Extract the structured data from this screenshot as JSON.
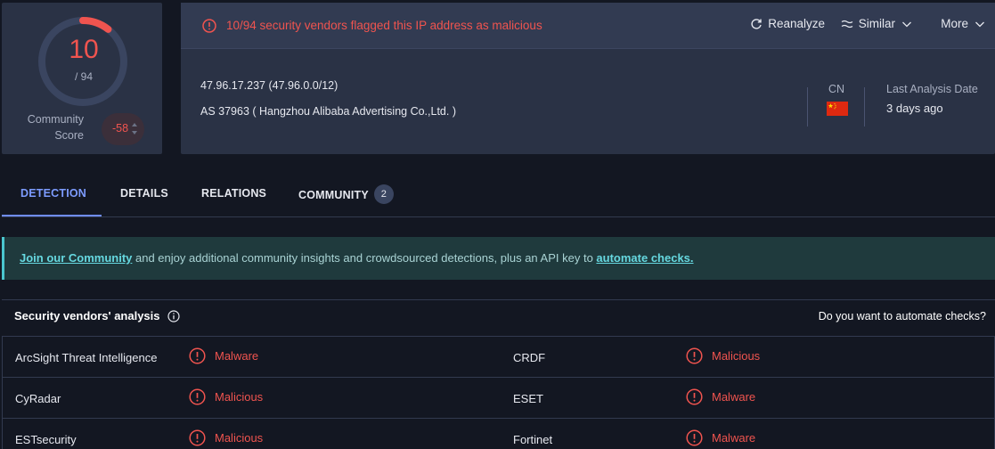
{
  "colors": {
    "accent": "#7d9cff",
    "danger": "#f0544f",
    "teal": "#66d8e0",
    "card": "#2a3245",
    "background": "#131722"
  },
  "score": {
    "detected": "10",
    "total": "/ 94",
    "community_label_1": "Community",
    "community_label_2": "Score",
    "community_value": "-58",
    "detection_ratio": 0.106
  },
  "header": {
    "alert_text": "10/94 security vendors flagged this IP address as malicious",
    "actions": {
      "reanalyze": "Reanalyze",
      "similar": "Similar",
      "more": "More"
    },
    "ip_line": "47.96.17.237  (47.96.0.0/12)",
    "as_line": "AS 37963  ( Hangzhou Alibaba Advertising Co.,Ltd. )",
    "country_code": "CN",
    "last_analysis_label": "Last Analysis Date",
    "last_analysis_value": "3 days ago"
  },
  "tabs": [
    {
      "label": "DETECTION"
    },
    {
      "label": "DETAILS"
    },
    {
      "label": "RELATIONS"
    },
    {
      "label": "COMMUNITY",
      "badge": "2"
    }
  ],
  "banner": {
    "link1": "Join our Community",
    "text": " and enjoy additional community insights and crowdsourced detections, plus an API key to ",
    "link2": "automate checks."
  },
  "vendors": {
    "title": "Security vendors' analysis",
    "automate_prompt": "Do you want to automate checks?",
    "rows": [
      {
        "left_name": "ArcSight Threat Intelligence",
        "left_result": "Malware",
        "right_name": "CRDF",
        "right_result": "Malicious"
      },
      {
        "left_name": "CyRadar",
        "left_result": "Malicious",
        "right_name": "ESET",
        "right_result": "Malware"
      },
      {
        "left_name": "ESTsecurity",
        "left_result": "Malicious",
        "right_name": "Fortinet",
        "right_result": "Malware"
      }
    ]
  }
}
